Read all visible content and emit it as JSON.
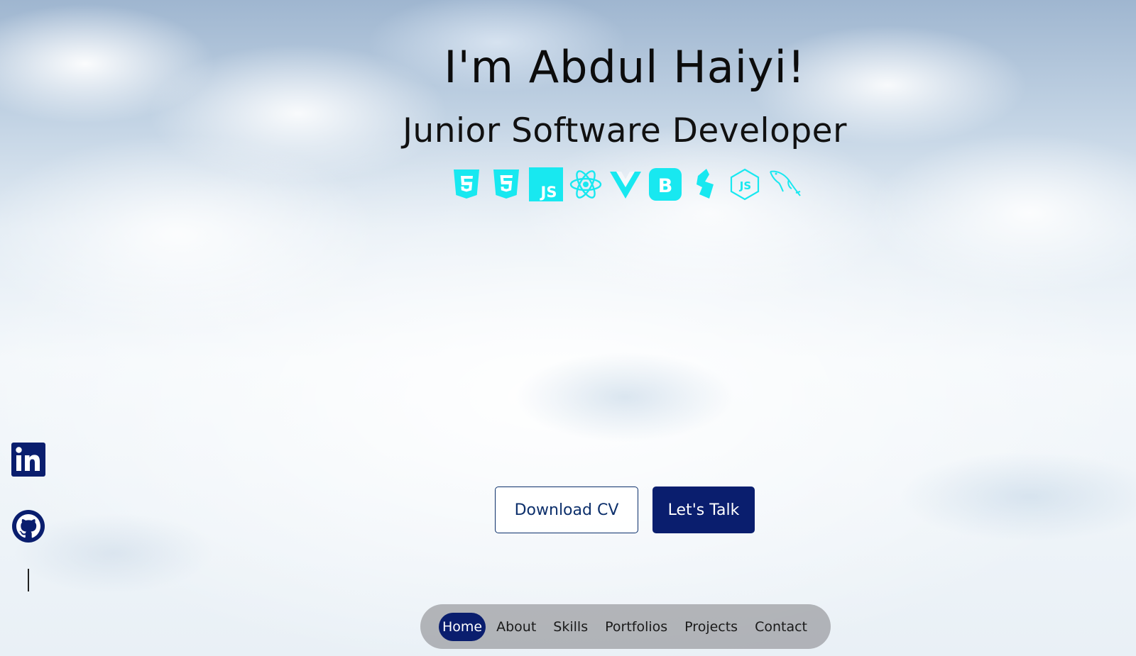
{
  "hero": {
    "title": "I'm Abdul Haiyi!",
    "subtitle": "Junior Software Developer"
  },
  "tech_icons": [
    {
      "name": "html5-icon"
    },
    {
      "name": "css3-icon"
    },
    {
      "name": "javascript-icon"
    },
    {
      "name": "react-icon"
    },
    {
      "name": "vue-icon"
    },
    {
      "name": "bootstrap-icon"
    },
    {
      "name": "blitz-icon"
    },
    {
      "name": "nodejs-icon"
    },
    {
      "name": "mysql-icon"
    }
  ],
  "tech_icon_color": "#18e8f0",
  "social": {
    "linkedin_icon": "linkedin-icon",
    "github_icon": "github-icon",
    "color": "#0a1e6e"
  },
  "cta": {
    "download_label": "Download CV",
    "talk_label": "Let's Talk"
  },
  "nav": {
    "items": [
      "Home",
      "About",
      "Skills",
      "Portfolios",
      "Projects",
      "Contact"
    ],
    "active": "Home"
  },
  "colors": {
    "primary": "#0a1e6e",
    "accent": "#18e8f0"
  }
}
